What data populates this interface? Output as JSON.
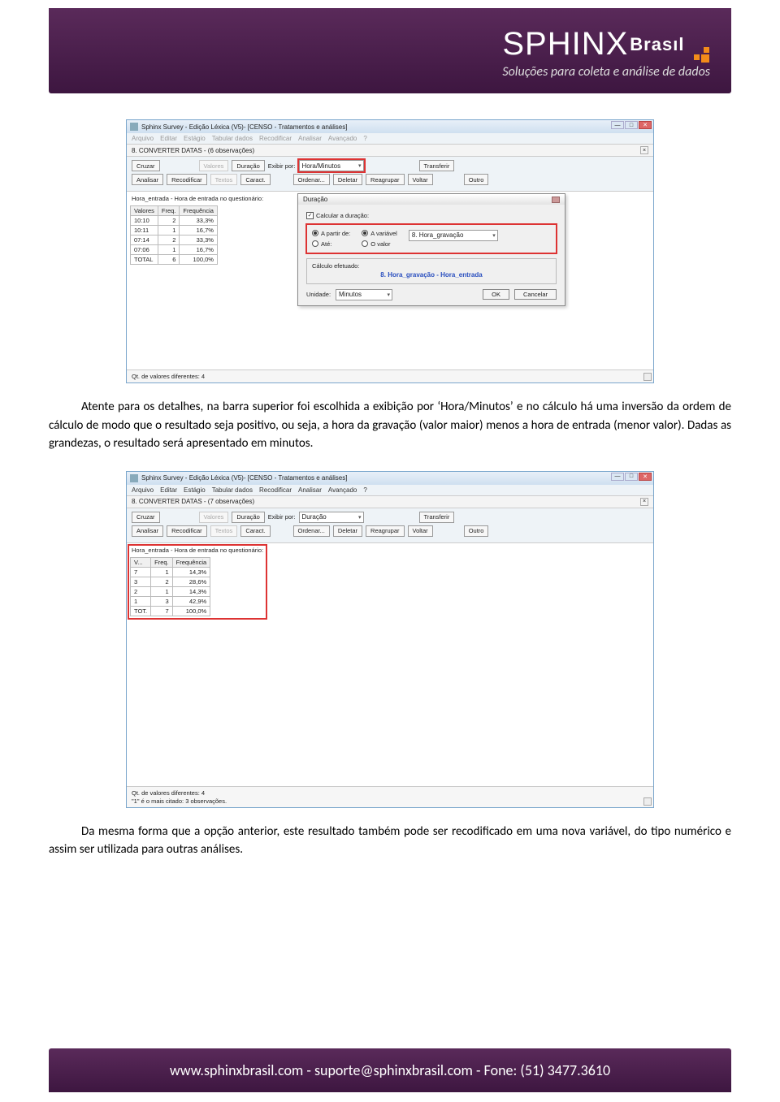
{
  "banner": {
    "brand_primary": "SPHINX",
    "brand_secondary": "Brasıl",
    "tagline": "Soluções para coleta e análise de dados",
    "footer": "www.sphinxbrasil.com - suporte@sphinxbrasil.com - Fone: (51) 3477.3610"
  },
  "para1": "Atente para os detalhes, na barra superior foi escolhida a exibição por ‘Hora/Minutos’ e no cálculo há uma inversão da ordem de cálculo de modo que o resultado seja positivo, ou seja, a hora da gravação (valor maior) menos a hora de entrada (menor valor). Dadas as grandezas, o resultado será apresentado em minutos.",
  "para2": "Da mesma forma que a opção anterior, este resultado também pode ser recodificado em uma nova variável, do tipo numérico e assim ser utilizada para outras análises.",
  "shot1": {
    "title": "Sphinx Survey - Edição Léxica (V5)- [CENSO - Tratamentos e análises]",
    "menus": [
      "Arquivo",
      "Editar",
      "Estágio",
      "Tabular dados",
      "Recodificar",
      "Analisar",
      "Avançado",
      "?"
    ],
    "tab": "8. CONVERTER DATAS - (6 observações)",
    "toolbar_row1": {
      "cruzar": "Cruzar",
      "valores": "Valores",
      "duracao": "Duração",
      "exibir_por": "Exibir por:",
      "combo_value": "Hora/Minutos",
      "transferir": "Transferir"
    },
    "toolbar_row2": {
      "analisar": "Analisar",
      "recodificar": "Recodificar",
      "textos": "Textos",
      "caract": "Caract.",
      "ordenar": "Ordenar...",
      "deletar": "Deletar",
      "reagrupar": "Reagrupar",
      "voltar": "Voltar",
      "outro": "Outro"
    },
    "section": "Hora_entrada - Hora de entrada no questionário:",
    "columns": [
      "Valores",
      "Freq.",
      "Frequência"
    ],
    "rows": [
      {
        "v": "10:10",
        "f": "2",
        "p": "33,3%"
      },
      {
        "v": "10:11",
        "f": "1",
        "p": "16,7%"
      },
      {
        "v": "07:14",
        "f": "2",
        "p": "33,3%"
      },
      {
        "v": "07:06",
        "f": "1",
        "p": "16,7%"
      },
      {
        "v": "TOTAL",
        "f": "6",
        "p": "100,0%"
      }
    ],
    "status": "Qt. de valores diferentes: 4",
    "dialog": {
      "title": "Duração",
      "chk": "Calcular a duração:",
      "apartir": "A partir de:",
      "ate": "Até:",
      "avariavel": "A variável",
      "ovalor": "O valor",
      "combo_var": "8. Hora_gravação",
      "calc_label": "Cálculo efetuado:",
      "calc_value": "8. Hora_gravação - Hora_entrada",
      "unidade_label": "Unidade:",
      "unidade_value": "Minutos",
      "ok": "OK",
      "cancelar": "Cancelar"
    }
  },
  "shot2": {
    "title": "Sphinx Survey - Edição Léxica (V5)- [CENSO - Tratamentos e análises]",
    "menus": [
      "Arquivo",
      "Editar",
      "Estágio",
      "Tabular dados",
      "Recodificar",
      "Analisar",
      "Avançado",
      "?"
    ],
    "tab": "8. CONVERTER DATAS - (7 observações)",
    "toolbar_row1": {
      "cruzar": "Cruzar",
      "valores": "Valores",
      "duracao": "Duração",
      "exibir_por": "Exibir por:",
      "combo_value": "Duração",
      "transferir": "Transferir"
    },
    "toolbar_row2": {
      "analisar": "Analisar",
      "recodificar": "Recodificar",
      "textos": "Textos",
      "caract": "Caract.",
      "ordenar": "Ordenar...",
      "deletar": "Deletar",
      "reagrupar": "Reagrupar",
      "voltar": "Voltar",
      "outro": "Outro"
    },
    "section": "Hora_entrada - Hora de entrada no questionário:",
    "columns": [
      "V...",
      "Freq.",
      "Frequência"
    ],
    "rows": [
      {
        "v": "7",
        "f": "1",
        "p": "14,3%"
      },
      {
        "v": "3",
        "f": "2",
        "p": "28,6%"
      },
      {
        "v": "2",
        "f": "1",
        "p": "14,3%"
      },
      {
        "v": "1",
        "f": "3",
        "p": "42,9%"
      },
      {
        "v": "TOT.",
        "f": "7",
        "p": "100,0%"
      }
    ],
    "status1": "Qt. de valores diferentes: 4",
    "status2": "\"1\" é o mais citado: 3 observações."
  }
}
